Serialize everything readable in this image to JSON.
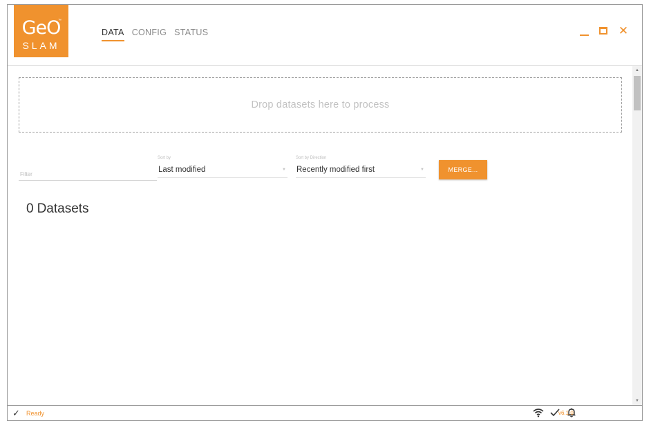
{
  "logo": {
    "line1": "GeO",
    "line2": "SLAM",
    "tm": "™"
  },
  "nav": {
    "tabs": [
      {
        "label": "DATA",
        "active": true
      },
      {
        "label": "CONFIG",
        "active": false
      },
      {
        "label": "STATUS",
        "active": false
      }
    ]
  },
  "window_controls": {
    "minimize_icon": "minimize-icon",
    "maximize_icon": "maximize-icon",
    "close_icon": "close-icon",
    "close_glyph": "✕"
  },
  "dropzone": {
    "text": "Drop datasets here to process"
  },
  "filter": {
    "placeholder": "Filter"
  },
  "sort_by": {
    "label": "Sort by",
    "value": "Last modified"
  },
  "sort_direction": {
    "label": "Sort by Direction",
    "value": "Recently modified first"
  },
  "merge_button": {
    "label": "MERGE..."
  },
  "datasets": {
    "count": "0",
    "label": "Datasets"
  },
  "statusbar": {
    "status": "Ready",
    "version": "v6.1.0"
  },
  "colors": {
    "accent": "#f0922e",
    "text": "#333333",
    "muted": "#8a8a8a"
  }
}
